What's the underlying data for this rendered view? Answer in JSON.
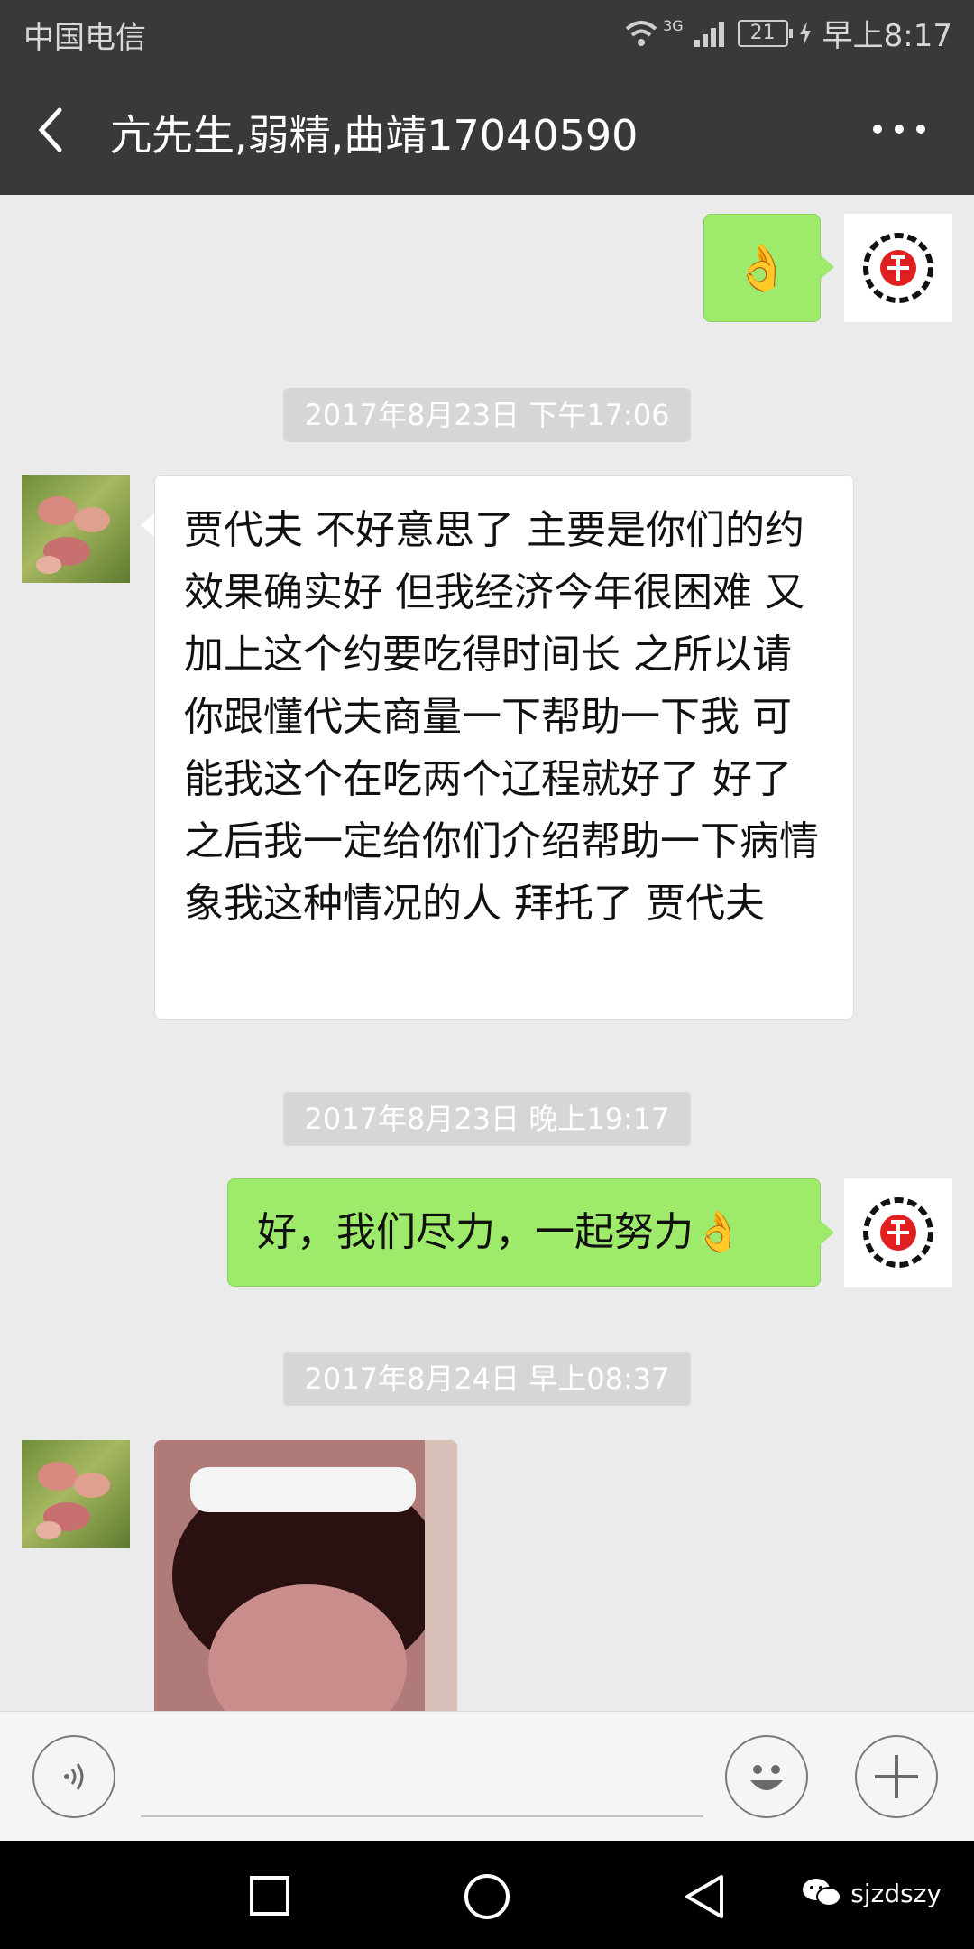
{
  "status_bar": {
    "carrier": "中国电信",
    "network": "3G",
    "battery": "21",
    "time": "早上8:17"
  },
  "nav": {
    "title": "亢先生,弱精,曲靖17040590"
  },
  "messages": {
    "m1": {
      "text": "👌"
    },
    "t1": "2017年8月23日 下午17:06",
    "m2": {
      "text": "贾代夫 不好意思了 主要是你们的约效果确实好 但我经济今年很困难 又加上这个约要吃得时间长 之所以请你跟懂代夫商量一下帮助一下我  可能我这个在吃两个辽程就好了 好了之后我一定给你们介绍帮助一下病情象我这种情况的人 拜托了 贾代夫"
    },
    "t2": "2017年8月23日 晚上19:17",
    "m3": {
      "text": "好，我们尽力，一起努力👌"
    },
    "t3": "2017年8月24日 早上08:37"
  },
  "watermark": "sjzdszy",
  "colors": {
    "bar_dark": "#393939",
    "chat_bg": "#ebebeb",
    "bubble_green": "#9eea6a",
    "bubble_white": "#ffffff",
    "timestamp_bg": "#d6d6d6"
  },
  "icons": [
    "back-arrow-icon",
    "more-icon",
    "voice-icon",
    "emoji-icon",
    "plus-icon",
    "recent-apps-icon",
    "home-icon",
    "back-triangle-icon",
    "wechat-icon",
    "wifi-icon",
    "signal-icon",
    "charging-icon"
  ]
}
